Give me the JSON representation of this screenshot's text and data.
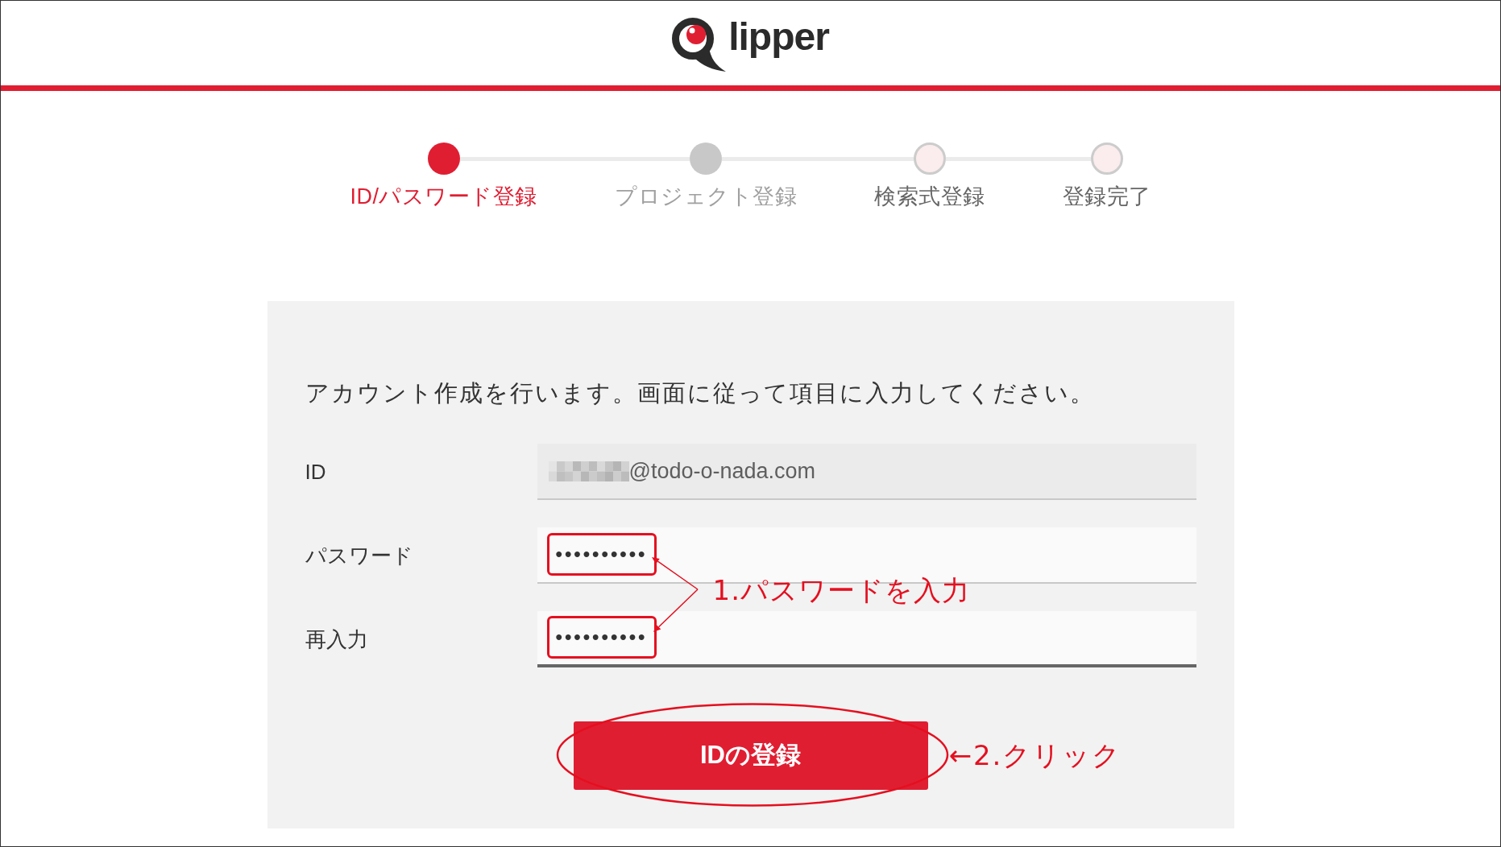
{
  "header": {
    "logo_text": "lipper"
  },
  "stepper": {
    "steps": [
      {
        "label": "ID/パスワード登録",
        "selected": true,
        "disabled": false
      },
      {
        "label": "プロジェクト登録",
        "selected": false,
        "disabled": true
      },
      {
        "label": "検索式登録",
        "selected": false,
        "disabled": false
      },
      {
        "label": "登録完了",
        "selected": false,
        "disabled": false
      }
    ]
  },
  "form": {
    "intro": "アカウント作成を行います。画面に従って項目に入力してください。",
    "fields": [
      {
        "kind": "readonly",
        "label": "ID",
        "value": "@todo-o-nada.com",
        "redacted": true,
        "highlighted": false,
        "focused": false
      },
      {
        "kind": "password",
        "label": "パスワード",
        "value": "••••••••••",
        "redacted": false,
        "highlighted": true,
        "focused": false
      },
      {
        "kind": "password",
        "label": "再入力",
        "value": "••••••••••",
        "redacted": false,
        "highlighted": true,
        "focused": true
      }
    ],
    "submit": {
      "label": "IDの登録",
      "circled": true
    }
  },
  "annotations": {
    "password_note": "1.パスワードを入力",
    "submit_note": "←2.クリック"
  }
}
